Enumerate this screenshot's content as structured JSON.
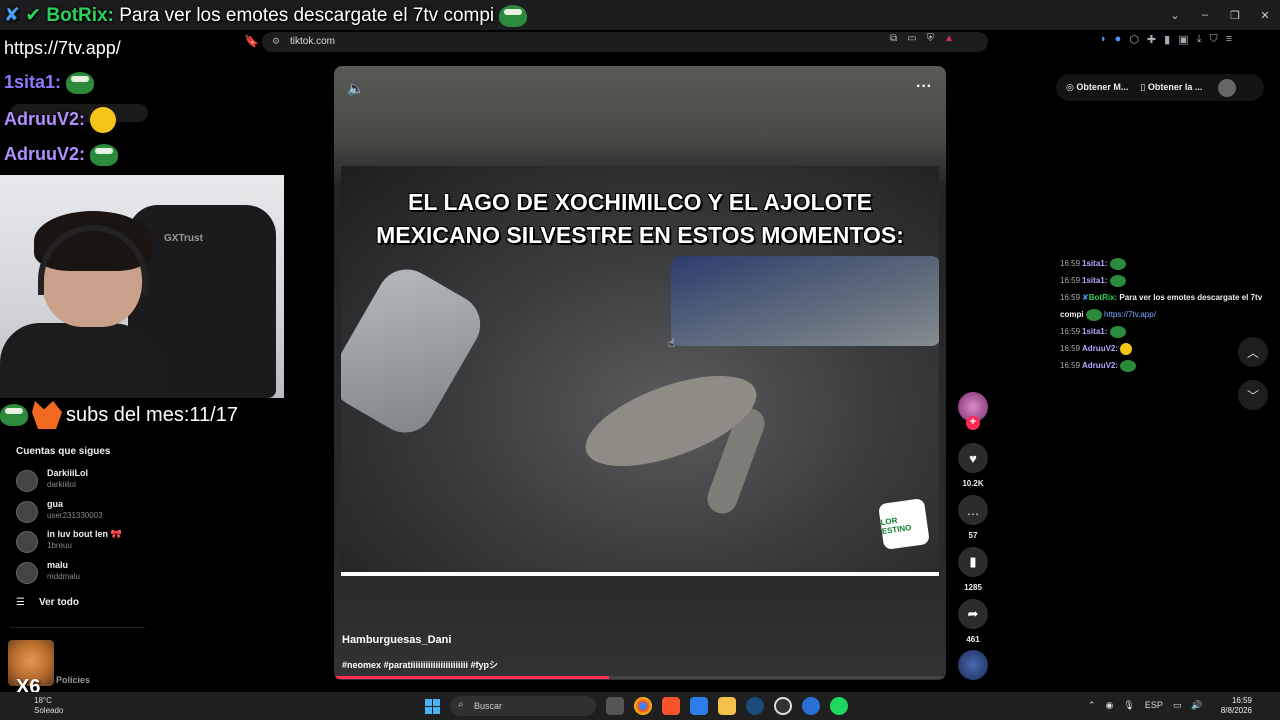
{
  "browser": {
    "url": "tiktok.com",
    "window_controls": [
      "⌄",
      "–",
      "❐",
      "✕"
    ]
  },
  "overlay": {
    "bot_name": "BotRix:",
    "bot_message": "Para ver los emotes descargate el 7tv compi",
    "link": "https://7tv.app/",
    "user1": "1sita1:",
    "user2": "AdruuV2:",
    "user3": "AdruuV2:",
    "subs_text": "subs del mes:11/17",
    "x6": "X6"
  },
  "webcam": {
    "chair_brand": "GXTrust"
  },
  "sidebar": {
    "following_title": "Cuentas que sigues",
    "following": [
      {
        "name": "DarkiiiLol",
        "handle": "darkiiilol"
      },
      {
        "name": "gua",
        "handle": "user231330003"
      },
      {
        "name": "in luv bout len 🎀",
        "handle": "1breuu"
      },
      {
        "name": "malu",
        "handle": "mddmalu"
      }
    ],
    "see_all": "Ver todo",
    "policies": "Policies"
  },
  "video": {
    "caption_line1": "EL LAGO DE XOCHIMILCO Y EL AJOLOTE",
    "caption_line2": "MEXICANO SILVESTRE EN ESTOS MOMENTOS:",
    "author": "Hamburguesas_Dani",
    "hashtags": "#neomex #paratiiiiiiiiiiiiiiiiiiiiiii #fypシ",
    "progress": 0.45,
    "badge_text": "LOR ESTINO"
  },
  "actions": {
    "likes": "10.2K",
    "comments": "57",
    "saves": "1285",
    "shares": "461"
  },
  "right_panel": {
    "pill_1": "Obtener M...",
    "pill_2": "Obtener la ...",
    "chat": [
      {
        "time": "16:59",
        "user": "1sita1:",
        "type": "pepe"
      },
      {
        "time": "16:59",
        "user": "1sita1:",
        "type": "pepe"
      },
      {
        "time": "16:59",
        "user": "BotRix:",
        "type": "bot",
        "message": "Para ver los emotes descargate el 7tv compi",
        "link": "https://7tv.app/"
      },
      {
        "time": "16:59",
        "user": "1sita1:",
        "type": "pepe"
      },
      {
        "time": "16:59",
        "user": "AdruuV2:",
        "type": "face"
      },
      {
        "time": "16:59",
        "user": "AdruuV2:",
        "type": "pepe"
      }
    ]
  },
  "taskbar": {
    "weather_temp": "18°C",
    "weather_desc": "Soleado",
    "search_label": "Buscar",
    "lang": "ESP",
    "time": "16:59",
    "date": "8/8/2026"
  }
}
